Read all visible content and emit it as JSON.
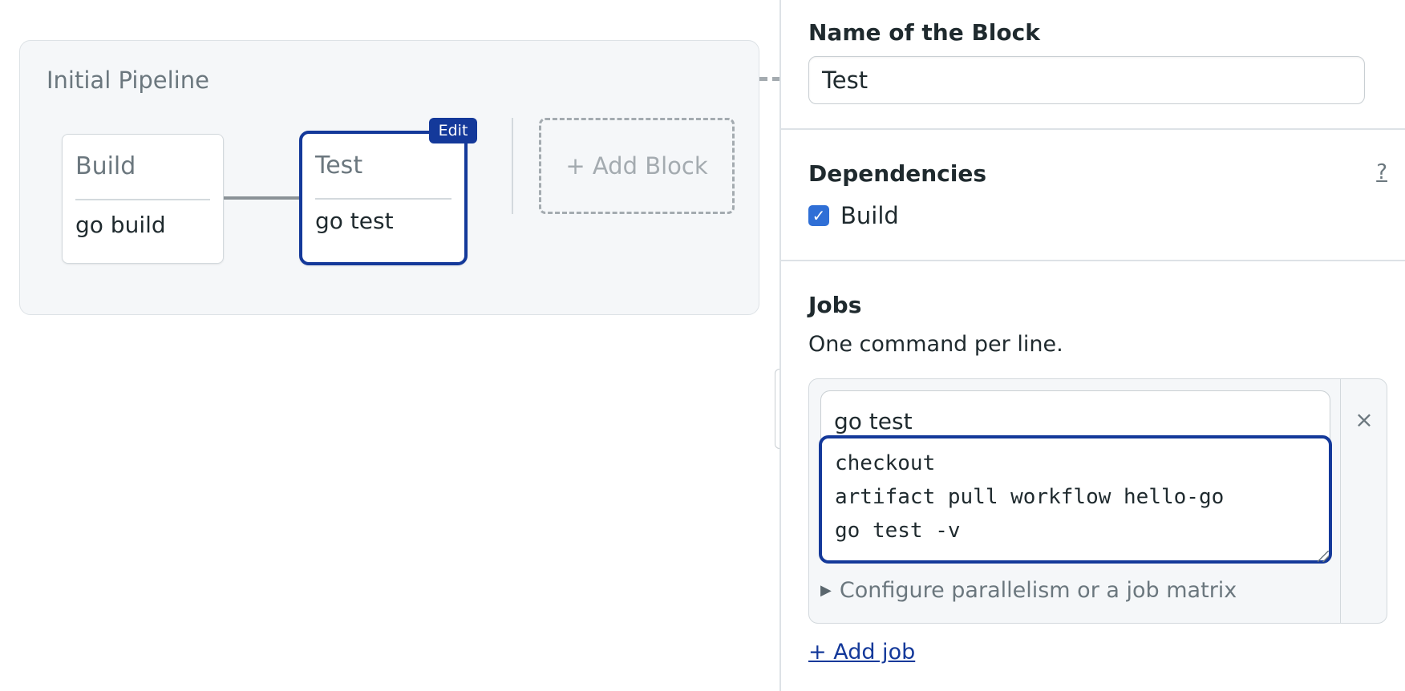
{
  "pipeline": {
    "title": "Initial Pipeline",
    "blocks": [
      {
        "name": "Build",
        "job": "go build"
      },
      {
        "name": "Test",
        "job": "go test",
        "badge": "Edit"
      }
    ],
    "add_block_label": "+ Add Block"
  },
  "panel": {
    "name_label": "Name of the Block",
    "name_value": "Test",
    "dependencies_label": "Dependencies",
    "help_label": "?",
    "dependency": {
      "label": "Build",
      "checked": true
    },
    "jobs_label": "Jobs",
    "jobs_hint": "One command per line.",
    "job": {
      "name": "go test",
      "commands": "checkout\nartifact pull workflow hello-go\ngo test -v",
      "remove_label": "×",
      "parallelism_label": "Configure parallelism or a job matrix",
      "toggle_glyph": "▶"
    },
    "add_job_label": "+ Add job",
    "checkmark": "✓"
  },
  "colors": {
    "accent": "#14399a",
    "checkbox": "#2f6fd6",
    "muted": "#6b777e"
  }
}
